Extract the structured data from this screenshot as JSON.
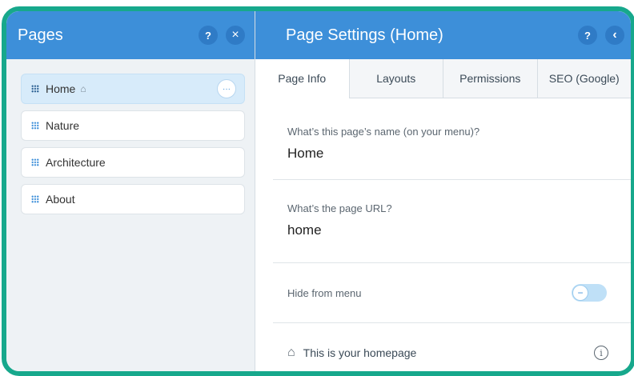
{
  "pages_panel": {
    "title": "Pages",
    "help_label": "?",
    "close_label": "×",
    "items": [
      {
        "label": "Home",
        "selected": true
      },
      {
        "label": "Nature"
      },
      {
        "label": "Architecture"
      },
      {
        "label": "About"
      }
    ],
    "more_label": "···"
  },
  "settings_panel": {
    "title": "Page Settings (Home)",
    "help_label": "?",
    "back_label": "‹",
    "tabs": [
      {
        "label": "Page Info",
        "active": true
      },
      {
        "label": "Layouts"
      },
      {
        "label": "Permissions"
      },
      {
        "label": "SEO (Google)"
      }
    ],
    "page_name": {
      "label": "What’s this page’s name (on your menu)?",
      "value": "Home"
    },
    "page_url": {
      "label": "What’s the page URL?",
      "value": "home"
    },
    "hide_menu": {
      "label": "Hide from menu",
      "on": false
    },
    "homepage": {
      "label": "This is your homepage",
      "info": "i"
    }
  },
  "colors": {
    "header": "#3d8fd9",
    "frame": "#17a88c",
    "selected": "#d7ebfa"
  }
}
